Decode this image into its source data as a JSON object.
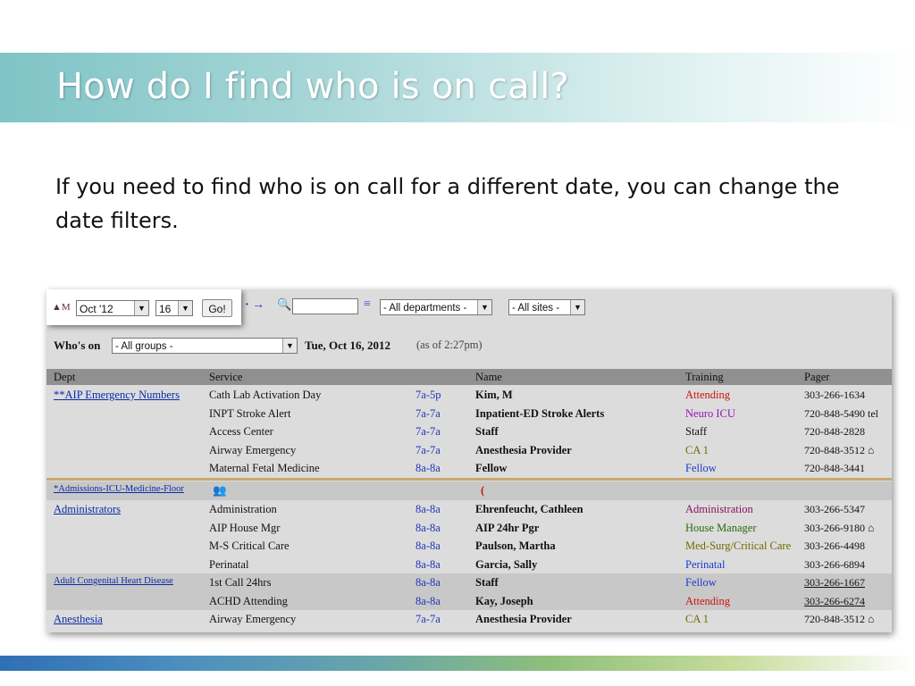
{
  "slide": {
    "title": "How do I find who is on call?",
    "body": "If you need to find who is on call for a different date, you can change the date filters."
  },
  "toolbar": {
    "month_select": "Oct '12",
    "day_select": "16",
    "go_button": "Go!",
    "department_select": "- All departments -",
    "sites_select": "- All sites -"
  },
  "filters": {
    "whos_on_label": "Who's on",
    "groups_select": "- All groups -",
    "date": "Tue, Oct 16, 2012",
    "as_of": "(as of 2:27pm)"
  },
  "table": {
    "headers": [
      "Dept",
      "Service",
      "",
      "Name",
      "Training",
      "Pager"
    ],
    "rows": [
      {
        "dept": "**AIP Emergency Numbers",
        "service": "Cath Lab Activation Day",
        "time": "7a-5p",
        "name": "Kim, M",
        "training": "Attending",
        "pager": "303-266-1634"
      },
      {
        "dept": "",
        "service": "INPT Stroke Alert",
        "time": "7a-7a",
        "name": "Inpatient-ED Stroke Alerts",
        "training": "Neuro ICU",
        "pager": "720-848-5490 tel"
      },
      {
        "dept": "",
        "service": "Access Center",
        "time": "7a-7a",
        "name": "Staff",
        "training": "Staff",
        "pager": "720-848-2828"
      },
      {
        "dept": "",
        "service": "Airway Emergency",
        "time": "7a-7a",
        "name": "Anesthesia Provider",
        "training": "CA 1",
        "pager": "720-848-3512 ⌂"
      },
      {
        "dept": "",
        "service": "Maternal Fetal Medicine",
        "time": "8a-8a",
        "name": "Fellow",
        "training": "Fellow",
        "pager": "720-848-3441"
      },
      {
        "dept": "*Admissions-ICU-Medicine-Floor",
        "service": "",
        "time": "",
        "name": "(",
        "training": "",
        "pager": ""
      },
      {
        "dept": "Administrators",
        "service": "Administration",
        "time": "8a-8a",
        "name": "Ehrenfeucht, Cathleen",
        "training": "Administration",
        "pager": "303-266-5347"
      },
      {
        "dept": "",
        "service": "AIP House Mgr",
        "time": "8a-8a",
        "name": "AIP 24hr Pgr",
        "training": "House Manager",
        "pager": "303-266-9180 ⌂"
      },
      {
        "dept": "",
        "service": "M-S Critical Care",
        "time": "8a-8a",
        "name": "Paulson, Martha",
        "training": "Med-Surg/Critical Care",
        "pager": "303-266-4498"
      },
      {
        "dept": "",
        "service": "Perinatal",
        "time": "8a-8a",
        "name": "Garcia, Sally",
        "training": "Perinatal",
        "pager": "303-266-6894"
      },
      {
        "dept": "Adult Congenital Heart Disease",
        "service": "1st Call 24hrs",
        "time": "8a-8a",
        "name": "Staff",
        "training": "Fellow",
        "pager": "303-266-1667"
      },
      {
        "dept": "",
        "service": "ACHD Attending",
        "time": "8a-8a",
        "name": "Kay, Joseph",
        "training": "Attending",
        "pager": "303-266-6274"
      },
      {
        "dept": "Anesthesia",
        "service": "Airway Emergency",
        "time": "7a-7a",
        "name": "Anesthesia Provider",
        "training": "CA 1",
        "pager": "720-848-3512 ⌂"
      }
    ]
  },
  "colors": {
    "attending": "#cc1111",
    "neuro_icu": "#9a10b8",
    "staff": "#111111",
    "ca1": "#6f6a00",
    "fellow": "#1a3ad0",
    "administration": "#8a1060",
    "house_manager": "#2a6a10",
    "med_surg": "#6f6a00",
    "perinatal": "#1a3ad0"
  }
}
